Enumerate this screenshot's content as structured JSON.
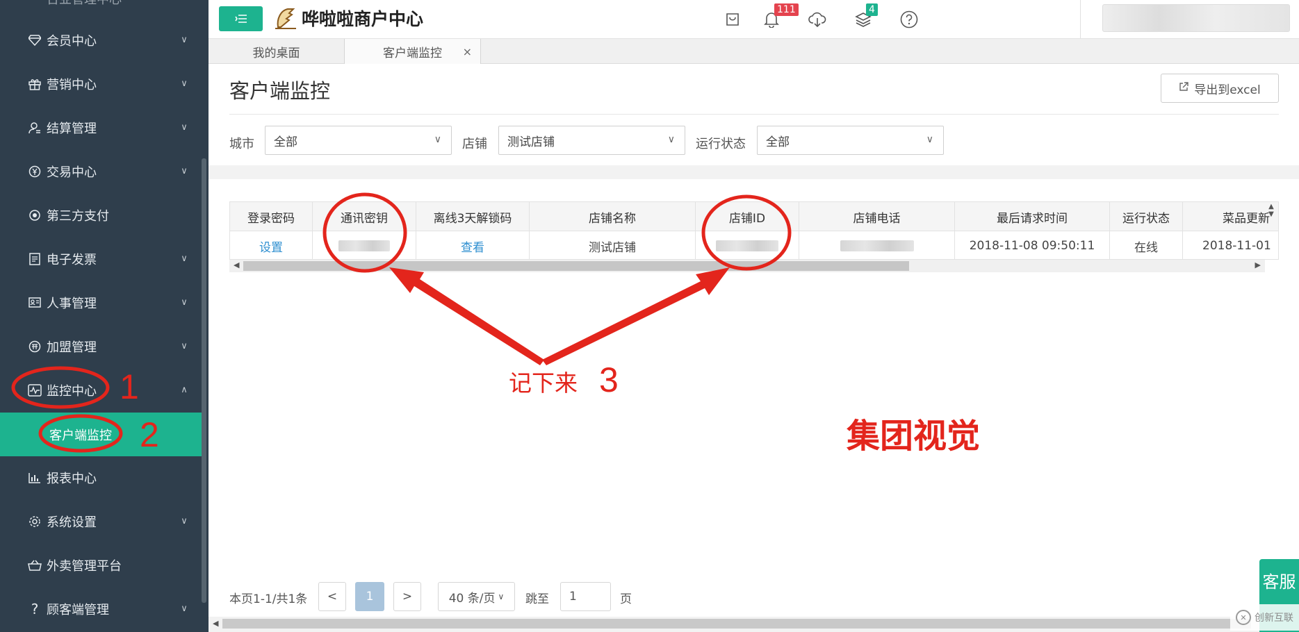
{
  "sidebar": {
    "partial_item": "台业管理中心",
    "items": [
      {
        "label": "会员中心",
        "icon": "diamond-icon",
        "chevron": "∨"
      },
      {
        "label": "营销中心",
        "icon": "gift-icon",
        "chevron": "∨"
      },
      {
        "label": "结算管理",
        "icon": "settlement-icon",
        "chevron": "∨"
      },
      {
        "label": "交易中心",
        "icon": "yen-icon",
        "chevron": "∨"
      },
      {
        "label": "第三方支付",
        "icon": "eye-icon",
        "chevron": ""
      },
      {
        "label": "电子发票",
        "icon": "invoice-icon",
        "chevron": "∨"
      },
      {
        "label": "人事管理",
        "icon": "id-card-icon",
        "chevron": "∨"
      },
      {
        "label": "加盟管理",
        "icon": "franchise-icon",
        "chevron": "∨"
      },
      {
        "label": "监控中心",
        "icon": "monitor-pulse-icon",
        "chevron": "∧"
      },
      {
        "label": "客户端监控",
        "icon": "",
        "chevron": "",
        "sub": true
      },
      {
        "label": "报表中心",
        "icon": "bar-chart-icon",
        "chevron": ""
      },
      {
        "label": "系统设置",
        "icon": "gear-icon",
        "chevron": "∨"
      },
      {
        "label": "外卖管理平台",
        "icon": "basket-icon",
        "chevron": ""
      },
      {
        "label": "顾客端管理",
        "icon": "question-icon",
        "chevron": "∨"
      }
    ]
  },
  "header": {
    "brand": "哗啦啦商户中心",
    "notifications_count": "111",
    "layers_count": "4"
  },
  "tabs": [
    {
      "label": "我的桌面"
    },
    {
      "label": "客户端监控",
      "close": "×"
    }
  ],
  "page": {
    "title": "客户端监控",
    "export_label": "导出到excel"
  },
  "filters": {
    "city": {
      "label": "城市",
      "value": "全部"
    },
    "shop": {
      "label": "店铺",
      "value": "测试店铺"
    },
    "status": {
      "label": "运行状态",
      "value": "全部"
    }
  },
  "table": {
    "columns": [
      "登录密码",
      "通讯密钥",
      "离线3天解锁码",
      "店铺名称",
      "店铺ID",
      "店铺电话",
      "最后请求时间",
      "运行状态",
      "菜品更新"
    ],
    "rows": [
      {
        "login_password": "设置",
        "comm_key": "",
        "unlock_code": "查看",
        "shop_name": "测试店铺",
        "shop_id": "",
        "shop_phone": "",
        "last_request": "2018-11-08 09:50:11",
        "status": "在线",
        "dish_update": "2018-11-01"
      }
    ]
  },
  "pagination": {
    "info": "本页1-1/共1条",
    "prev": "<",
    "current": "1",
    "next": ">",
    "page_size": "40 条/页",
    "jump_label": "跳至",
    "jump_value": "1",
    "page_unit": "页"
  },
  "service_button": "客服",
  "watermark": "创新互联",
  "annotations": {
    "step1": "1",
    "step2": "2",
    "step3_text": "记下来",
    "step3_num": "3",
    "watermark_text": "集团视觉",
    "color": "#e3251c"
  },
  "colors": {
    "sidebar_bg": "#2f3e4c",
    "accent": "#1db38f",
    "link": "#2f8fd0",
    "badge_red": "#e4434e"
  }
}
